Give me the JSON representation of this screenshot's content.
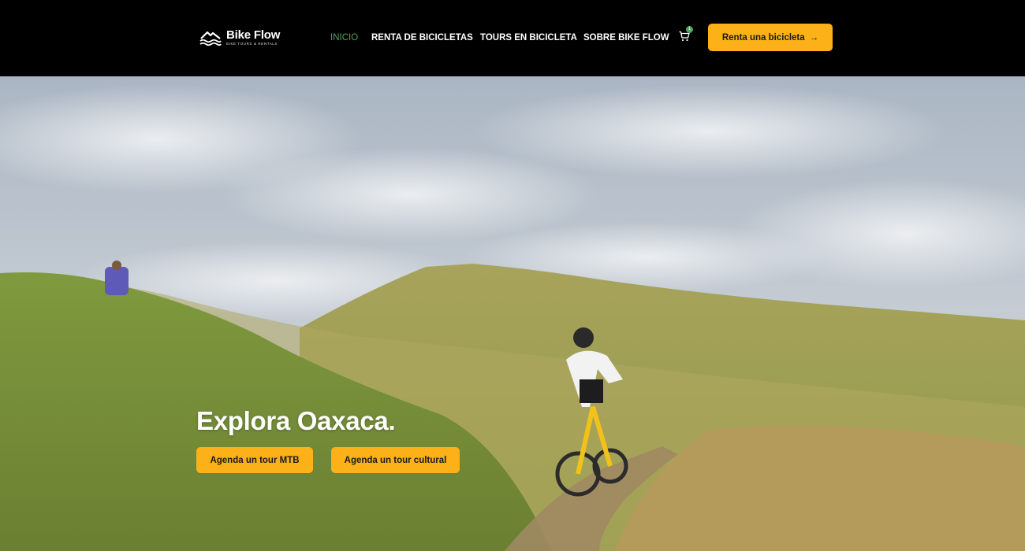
{
  "brand": {
    "name": "Bike Flow",
    "tagline": "BIKE TOURS & RENTALS",
    "icon": "mountain-waves-logo-icon"
  },
  "nav": {
    "items": [
      {
        "label": "INICIO",
        "active": true
      },
      {
        "label": "RENTA DE BICICLETAS",
        "active": false
      },
      {
        "label": "TOURS EN BICICLETA",
        "active": false
      },
      {
        "label": "SOBRE BIKE FLOW",
        "active": false
      }
    ],
    "cart_icon": "cart-icon",
    "cart_count": "1",
    "cta_label": "Renta una bicicleta",
    "cta_arrow": "→"
  },
  "hero": {
    "title": "Explora Oaxaca.",
    "buttons": [
      {
        "label": "Agenda un tour MTB"
      },
      {
        "label": "Agenda un tour cultural"
      }
    ],
    "background_description_icon": "mountain-biker-photo"
  },
  "colors": {
    "header_bg": "#000000",
    "accent_yellow": "#fbb117",
    "active_green": "#4fa35a"
  }
}
